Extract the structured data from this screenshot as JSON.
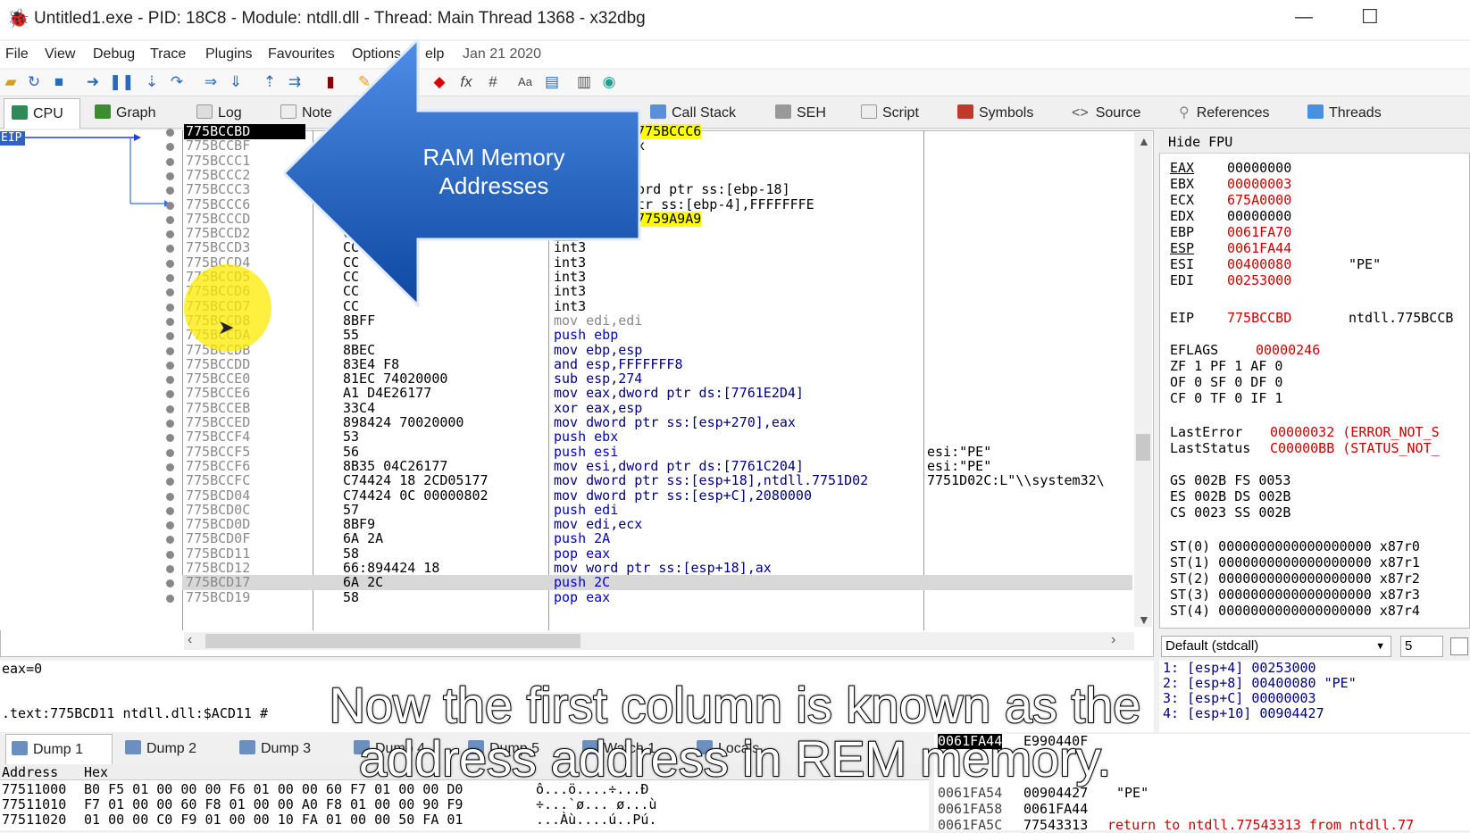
{
  "window": {
    "title": "Untitled1.exe - PID: 18C8 - Module: ntdll.dll - Thread: Main Thread 1368 - x32dbg",
    "minimize": "—",
    "maximize": "☐"
  },
  "menu": [
    "File",
    "View",
    "Debug",
    "Trace",
    "Plugins",
    "Favourites",
    "Options",
    "elp",
    "Jan 21 2020"
  ],
  "tabs": [
    "CPU",
    "Graph",
    "Log",
    "Note",
    "",
    "Call Stack",
    "SEH",
    "Script",
    "Symbols",
    "Source",
    "References",
    "Threads"
  ],
  "callout": {
    "line1": "RAM Memory",
    "line2": "Addresses"
  },
  "disasm": {
    "addresses": [
      "775BCCBD",
      "775BCCBF",
      "775BCCC1",
      "775BCCC2",
      "775BCCC3",
      "775BCCC6",
      "775BCCCD",
      "775BCCD2",
      "775BCCD3",
      "775BCCD4",
      "775BCCD5",
      "775BCCD6",
      "775BCCD7",
      "775BCCD8",
      "775BCCDA",
      "775BCCDB",
      "775BCCDD",
      "775BCCE0",
      "775BCCE6",
      "775BCCEB",
      "775BCCED",
      "775BCCF4",
      "775BCCF5",
      "775BCCF6",
      "775BCCFC",
      "775BCD04",
      "775BCD0C",
      "775BCD0D",
      "775BCD0F",
      "775BCD11",
      "775BCD12",
      "775BCD17",
      "775BCD19"
    ],
    "bytes": [
      "",
      "",
      "",
      "",
      "",
      "",
      "",
      "C3",
      "CC",
      "CC",
      "CC",
      "CC",
      "CC",
      "8BFF",
      "55",
      "8BEC",
      "83E4 F8",
      "81EC 74020000",
      "A1 D4E26177",
      "33C4",
      "898424 70020000",
      "53",
      "56",
      "8B35 04C26177",
      "C74424 18 2CD05177",
      "C74424 0C 00000802",
      "57",
      "8BF9",
      "6A 2A",
      "58",
      "66:894424 18",
      "6A 2C",
      "58"
    ],
    "instr": [
      ".775BCCC6",
      "ax",
      "",
      "",
      "word ptr ss:[ebp-18]",
      "ptr ss:[ebp-4],FFFFFFFE",
      ".7759A9A9",
      "ret",
      "int3",
      "int3",
      "int3",
      "int3",
      "int3",
      "mov edi,edi",
      "push ebp",
      "mov ebp,esp",
      "and esp,FFFFFFF8",
      "sub esp,274",
      "mov eax,dword ptr ds:[7761E2D4]",
      "xor eax,esp",
      "mov dword ptr ss:[esp+270],eax",
      "push ebx",
      "push esi",
      "mov esi,dword ptr ds:[7761C204]",
      "mov dword ptr ss:[esp+18],ntdll.7751D02",
      "mov dword ptr ss:[esp+C],2080000",
      "push edi",
      "mov edi,ecx",
      "push 2A",
      "pop eax",
      "mov word ptr ss:[esp+18],ax",
      "push 2C",
      "pop eax"
    ],
    "comments": [
      "",
      "",
      "",
      "",
      "",
      "",
      "",
      "",
      "",
      "",
      "",
      "",
      "",
      "",
      "",
      "",
      "",
      "",
      "",
      "",
      "",
      "",
      "esi:\"PE\"",
      "esi:\"PE\"",
      "7751D02C:L\"\\\\system32\\",
      "",
      "",
      "",
      "",
      "",
      "",
      "",
      ""
    ],
    "eip_label": "EIP"
  },
  "registers": {
    "header": "Hide FPU",
    "gpr": [
      {
        "name": "EAX",
        "value": "00000000",
        "changed": false,
        "extra": ""
      },
      {
        "name": "EBX",
        "value": "00000003",
        "changed": true,
        "extra": ""
      },
      {
        "name": "ECX",
        "value": "675A0000",
        "changed": true,
        "extra": ""
      },
      {
        "name": "EDX",
        "value": "00000000",
        "changed": false,
        "extra": ""
      },
      {
        "name": "EBP",
        "value": "0061FA70",
        "changed": true,
        "extra": ""
      },
      {
        "name": "ESP",
        "value": "0061FA44",
        "changed": true,
        "extra": ""
      },
      {
        "name": "ESI",
        "value": "00400080",
        "changed": true,
        "extra": "\"PE\""
      },
      {
        "name": "EDI",
        "value": "00253000",
        "changed": true,
        "extra": ""
      }
    ],
    "eip": {
      "name": "EIP",
      "value": "775BCCBD",
      "extra": "ntdll.775BCCB"
    },
    "eflags": {
      "name": "EFLAGS",
      "value": "00000246"
    },
    "flags": [
      "ZF 1   PF 1   AF 0",
      "OF 0   SF 0   DF 0",
      "CF 0   TF 0   IF 1"
    ],
    "last_error": {
      "name": "LastError",
      "value": "00000032 (ERROR_NOT_S"
    },
    "last_status": {
      "name": "LastStatus",
      "value": "C00000BB (STATUS_NOT_"
    },
    "segs": [
      "GS 002B  FS 0053",
      "ES 002B  DS 002B",
      "CS 0023  SS 002B"
    ],
    "st": [
      "ST(0) 0000000000000000000 x87r0",
      "ST(1) 0000000000000000000 x87r1",
      "ST(2) 0000000000000000000 x87r2",
      "ST(3) 0000000000000000000 x87r3",
      "ST(4) 0000000000000000000 x87r4"
    ]
  },
  "callconv": {
    "value": "Default (stdcall)",
    "count": "5"
  },
  "stack_args": [
    "1: [esp+4]  00253000",
    "2: [esp+8]  00400080 \"PE\"",
    "3: [esp+C]  00000003",
    "4: [esp+10] 00904427"
  ],
  "info": {
    "line1": "eax=0",
    "line2": ".text:775BCD11 ntdll.dll:$ACD11 #"
  },
  "dump_tabs": [
    "Dump 1",
    "Dump 2",
    "Dump 3",
    "Dump 4",
    "Dump 5",
    "Watch 1",
    "Locals"
  ],
  "dump": {
    "header_addr": "Address",
    "header_hex": "Hex",
    "rows": [
      {
        "addr": "77511000",
        "hex": "B0 F5 01 00 00 00 F6 01 00 00 60 F7 01 00 00 D0",
        "ascii": "ô...ö....÷...Ð"
      },
      {
        "addr": "77511010",
        "hex": "F7 01 00 00 60 F8 01 00 00 A0 F8 01 00 00 90 F9",
        "ascii": "÷...`ø... ø...ù"
      },
      {
        "addr": "77511020",
        "hex": "01 00 00 C0 F9 01 00 00 10 FA 01 00 00 50 FA 01",
        "ascii": "...Àù....ú..Pú."
      }
    ]
  },
  "stack": {
    "rows": [
      {
        "addr": "0061FA44",
        "value": "E990440F",
        "comment": ""
      },
      {
        "addr": "0061FA54",
        "value": "00904427",
        "comment": "\"PE\""
      },
      {
        "addr": "0061FA58",
        "value": "0061FA44",
        "comment": ""
      },
      {
        "addr": "0061FA5C",
        "value": "77543313",
        "comment": "return to ntdll.77543313 from ntdll.77"
      }
    ]
  },
  "subtitle": {
    "line1": "Now the first column is known as the",
    "line2": "address address in REM memory."
  },
  "colors": {
    "accent": "#2a6bb8",
    "callout": "#1565c0",
    "highlight": "#ffff00",
    "cyan": "#00e5ff",
    "changed": "#cc0000"
  }
}
